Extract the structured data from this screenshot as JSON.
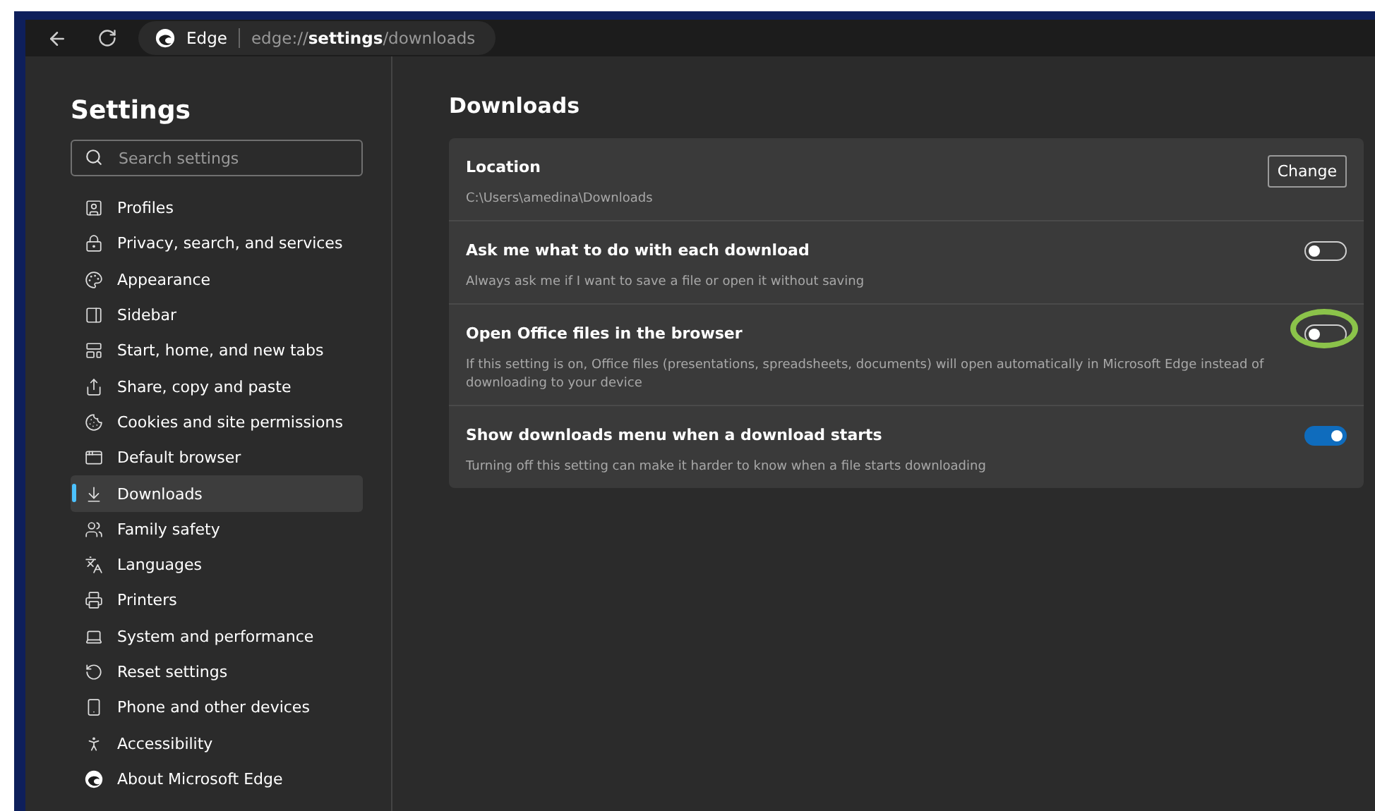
{
  "toolbar": {
    "site_label": "Edge",
    "address": "edge://**settings**/downloads"
  },
  "sidebar": {
    "title": "Settings",
    "search": {
      "placeholder": "Search settings"
    },
    "items": [
      {
        "label": "Profiles",
        "selected": false
      },
      {
        "label": "Privacy, search, and services",
        "selected": false
      },
      {
        "label": "Appearance",
        "selected": false
      },
      {
        "label": "Sidebar",
        "selected": false
      },
      {
        "label": "Start, home, and new tabs",
        "selected": false
      },
      {
        "label": "Share, copy and paste",
        "selected": false
      },
      {
        "label": "Cookies and site permissions",
        "selected": false
      },
      {
        "label": "Default browser",
        "selected": false
      },
      {
        "label": "Downloads",
        "selected": true
      },
      {
        "label": "Family safety",
        "selected": false
      },
      {
        "label": "Languages",
        "selected": false
      },
      {
        "label": "Printers",
        "selected": false
      },
      {
        "label": "System and performance",
        "selected": false
      },
      {
        "label": "Reset settings",
        "selected": false
      },
      {
        "label": "Phone and other devices",
        "selected": false
      },
      {
        "label": "Accessibility",
        "selected": false
      },
      {
        "label": "About Microsoft Edge",
        "selected": false
      }
    ]
  },
  "main": {
    "title": "Downloads",
    "settings": [
      {
        "kind": "button",
        "title": "Location",
        "description": "C:\\Users\\amedina\\Downloads",
        "button": "Change"
      },
      {
        "kind": "toggle",
        "title": "Ask me what to do with each download",
        "description": "Always ask me if I want to save a file or open it without saving",
        "on": false,
        "highlighted": false
      },
      {
        "kind": "toggle",
        "title": "Open Office files in the browser",
        "description": "If this setting is on, Office files (presentations, spreadsheets, documents) will open automatically in Microsoft Edge instead of downloading to your device",
        "on": false,
        "highlighted": true
      },
      {
        "kind": "toggle",
        "title": "Show downloads menu when a download starts",
        "description": "Turning off this setting can make it harder to know when a file starts downloading",
        "on": true,
        "highlighted": false
      }
    ]
  }
}
